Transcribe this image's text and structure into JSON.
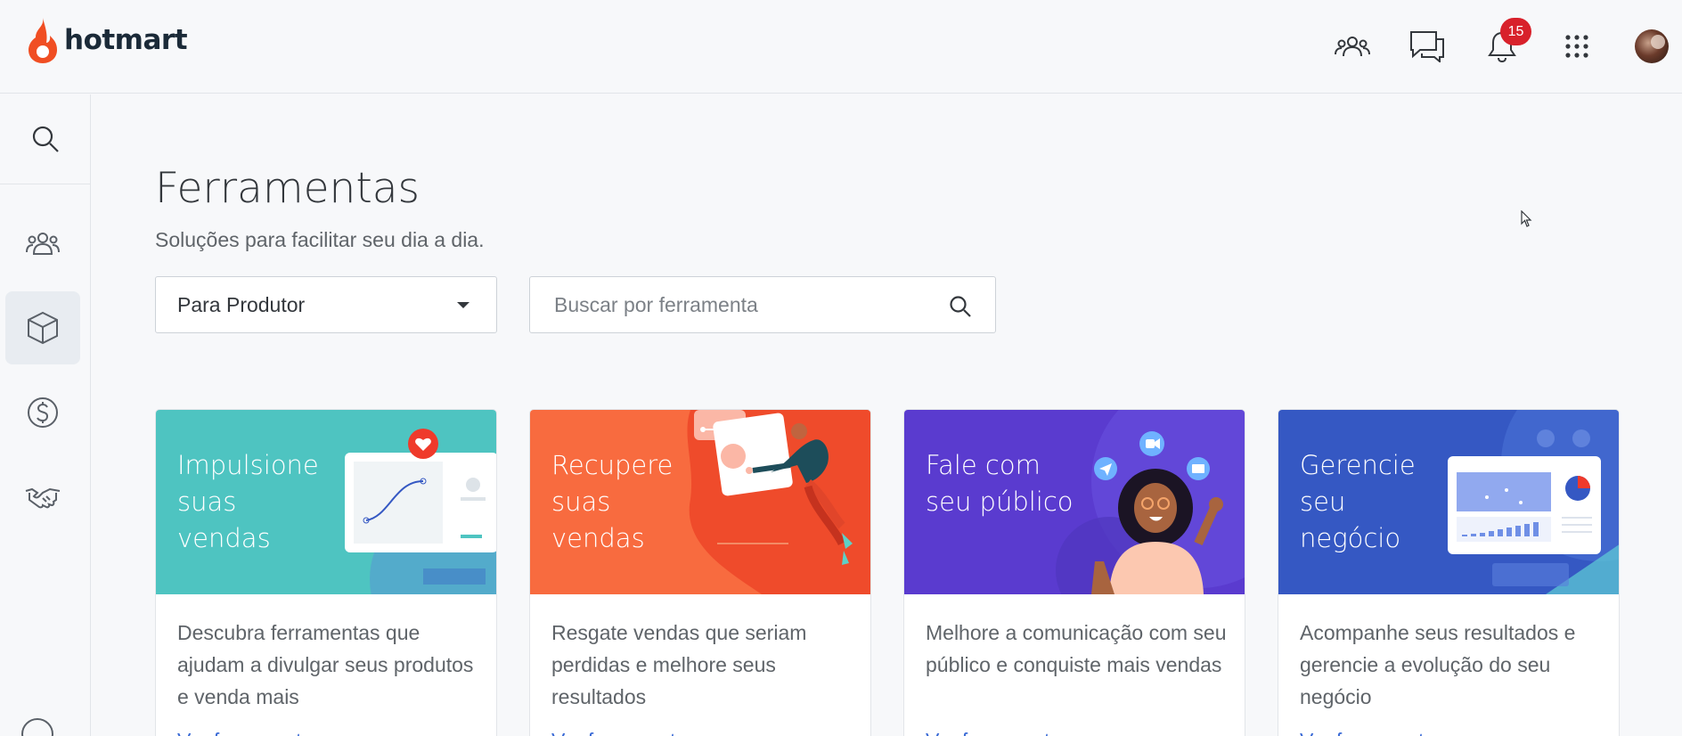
{
  "header": {
    "logo_text": "hotmart",
    "icons": [
      "community-icon",
      "chat-icon",
      "bell-icon",
      "apps-grid-icon"
    ],
    "notifications_count": "15"
  },
  "sidebar": {
    "items": [
      {
        "icon": "search-icon"
      },
      {
        "icon": "users-icon"
      },
      {
        "icon": "box-icon",
        "active": true
      },
      {
        "icon": "dollar-icon"
      },
      {
        "icon": "handshake-icon"
      }
    ]
  },
  "main": {
    "title": "Ferramentas",
    "subtitle": "Soluções para facilitar seu dia a dia.",
    "filter": {
      "selected": "Para Produtor"
    },
    "search": {
      "placeholder": "Buscar por ferramenta"
    },
    "cards": [
      {
        "title": "Impulsione suas vendas",
        "description": "Descubra ferramentas que ajudam a divulgar seus produtos e venda mais",
        "link": "Ver ferramentas",
        "color": "#4ec4c1"
      },
      {
        "title": "Recupere suas vendas",
        "description": "Resgate vendas que seriam perdidas e melhore seus resultados",
        "link": "Ver ferramentas",
        "color": "#f86b3f"
      },
      {
        "title": "Fale com seu público",
        "description": "Melhore a comunicação com seu público e conquiste mais vendas",
        "link": "Ver ferramentas",
        "color": "#5a3bcf"
      },
      {
        "title": "Gerencie seu negócio",
        "description": "Acompanhe seus resultados e gerencie a evolução do seu negócio",
        "link": "Ver ferramentas",
        "color": "#3558c3"
      }
    ]
  },
  "colors": {
    "brand": "#f04e23",
    "link": "#3b6bd6",
    "badge": "#d8212b"
  }
}
